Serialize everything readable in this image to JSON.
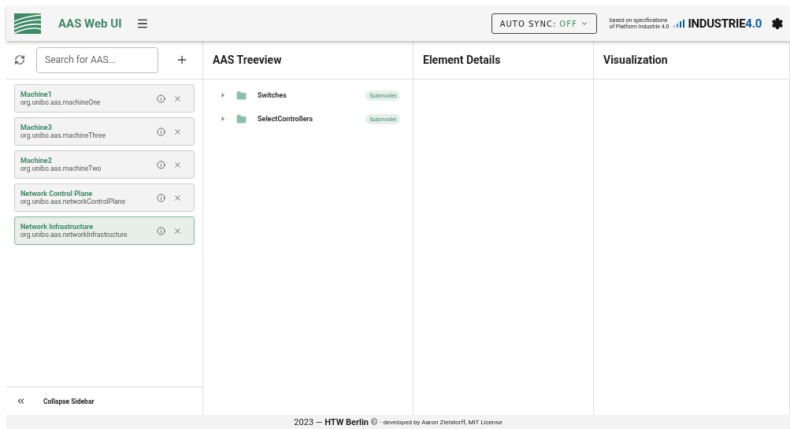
{
  "header": {
    "title": "AAS Web UI",
    "auto_sync": {
      "label": "AUTO SYNC:",
      "value": "OFF",
      "on": false
    },
    "spec_note": [
      "based on specifications",
      "of Platform Industrie 4.0"
    ],
    "brand": {
      "main": "INDUSTRIE",
      "version": "4.0"
    }
  },
  "sidebar": {
    "search": {
      "placeholder": "Search for AAS..."
    },
    "items": [
      {
        "name": "Machine1",
        "id": "org.unibo.aas.machineOne",
        "selected": false
      },
      {
        "name": "Machine3",
        "id": "org.unibo.aas.machineThree",
        "selected": false
      },
      {
        "name": "Machine2",
        "id": "org.unibo.aas.machineTwo",
        "selected": false
      },
      {
        "name": "Network Control Plane",
        "id": "org.unibo.aas.networkControlPlane",
        "selected": false
      },
      {
        "name": "Network Infrastructure",
        "id": "org.unibo.aas.networkInfrastructure",
        "selected": true
      }
    ],
    "collapse": "Collapse Sidebar"
  },
  "panels": [
    {
      "title": "AAS Treeview",
      "kind": "tree",
      "nodes": [
        {
          "label": "Switches",
          "badge": "Submodel",
          "expanded": false
        },
        {
          "label": "SelectControllers",
          "badge": "Submodel",
          "expanded": false
        }
      ]
    },
    {
      "title": "Element Details",
      "kind": "empty"
    },
    {
      "title": "Visualization",
      "kind": "empty"
    }
  ],
  "footer": {
    "text": "2023 — **HTW Berlin** ©",
    "note": "- developed by Aaron Zielstorff, MIT License"
  }
}
